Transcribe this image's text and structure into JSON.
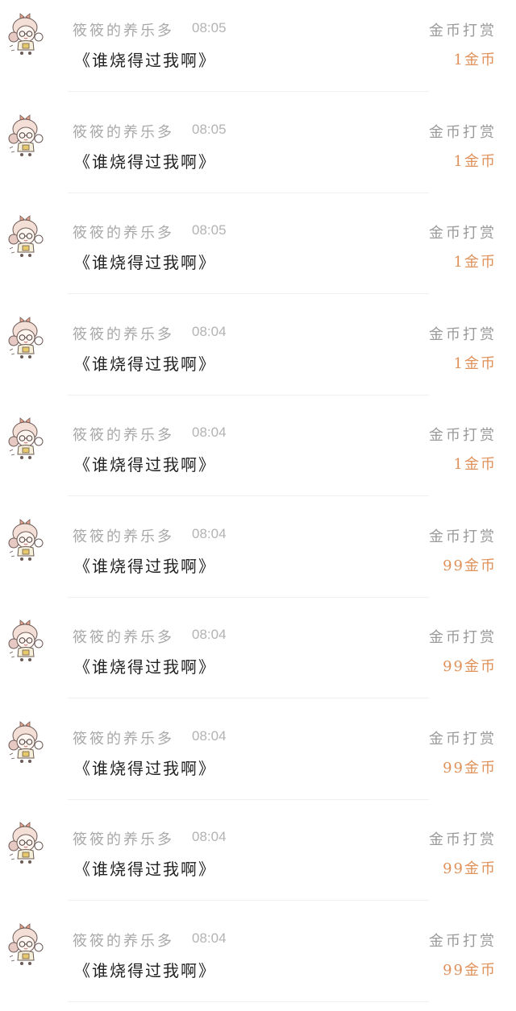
{
  "rows": [
    {
      "name": "筱筱的养乐多",
      "time": "08:05",
      "message": "《谁烧得过我啊》",
      "gift_label": "金币打赏",
      "gift_amount": "1金币",
      "avatar": "cartoon-girl-avatar"
    },
    {
      "name": "筱筱的养乐多",
      "time": "08:05",
      "message": "《谁烧得过我啊》",
      "gift_label": "金币打赏",
      "gift_amount": "1金币",
      "avatar": "cartoon-girl-avatar"
    },
    {
      "name": "筱筱的养乐多",
      "time": "08:05",
      "message": "《谁烧得过我啊》",
      "gift_label": "金币打赏",
      "gift_amount": "1金币",
      "avatar": "cartoon-girl-avatar"
    },
    {
      "name": "筱筱的养乐多",
      "time": "08:04",
      "message": "《谁烧得过我啊》",
      "gift_label": "金币打赏",
      "gift_amount": "1金币",
      "avatar": "cartoon-girl-avatar"
    },
    {
      "name": "筱筱的养乐多",
      "time": "08:04",
      "message": "《谁烧得过我啊》",
      "gift_label": "金币打赏",
      "gift_amount": "1金币",
      "avatar": "cartoon-girl-avatar"
    },
    {
      "name": "筱筱的养乐多",
      "time": "08:04",
      "message": "《谁烧得过我啊》",
      "gift_label": "金币打赏",
      "gift_amount": "99金币",
      "avatar": "cartoon-girl-avatar"
    },
    {
      "name": "筱筱的养乐多",
      "time": "08:04",
      "message": "《谁烧得过我啊》",
      "gift_label": "金币打赏",
      "gift_amount": "99金币",
      "avatar": "cartoon-girl-avatar"
    },
    {
      "name": "筱筱的养乐多",
      "time": "08:04",
      "message": "《谁烧得过我啊》",
      "gift_label": "金币打赏",
      "gift_amount": "99金币",
      "avatar": "cartoon-girl-avatar"
    },
    {
      "name": "筱筱的养乐多",
      "time": "08:04",
      "message": "《谁烧得过我啊》",
      "gift_label": "金币打赏",
      "gift_amount": "99金币",
      "avatar": "cartoon-girl-avatar"
    },
    {
      "name": "筱筱的养乐多",
      "time": "08:04",
      "message": "《谁烧得过我啊》",
      "gift_label": "金币打赏",
      "gift_amount": "99金币",
      "avatar": "cartoon-girl-avatar"
    }
  ],
  "colors": {
    "name": "#a9a9a9",
    "time": "#b3b3b3",
    "message": "#222222",
    "gift_label": "#9a9a9a",
    "gift_amount": "#e0915a",
    "divider": "#f1f1f1"
  }
}
